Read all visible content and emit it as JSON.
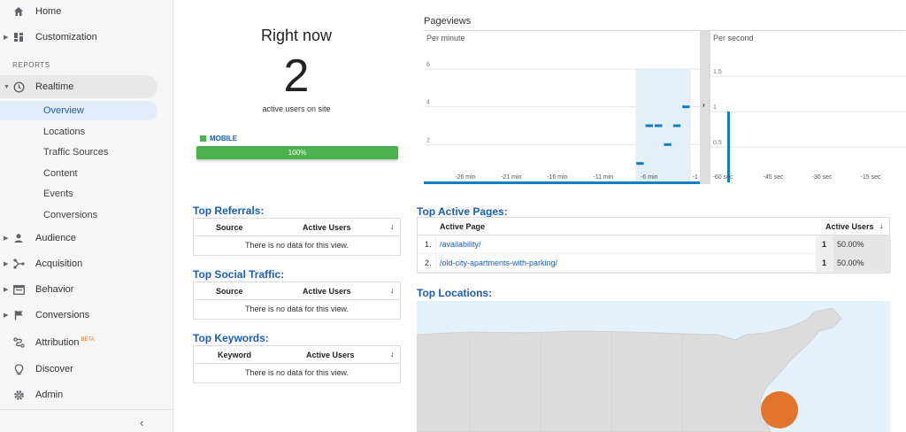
{
  "sidebar": {
    "home": "Home",
    "customization": "Customization",
    "reports_label": "REPORTS",
    "realtime": "Realtime",
    "realtime_items": [
      "Overview",
      "Locations",
      "Traffic Sources",
      "Content",
      "Events",
      "Conversions"
    ],
    "audience": "Audience",
    "acquisition": "Acquisition",
    "behavior": "Behavior",
    "conversions": "Conversions",
    "attribution": "Attribution",
    "attribution_badge": "BETA",
    "discover": "Discover",
    "admin": "Admin",
    "collapse": "‹"
  },
  "right_now": {
    "title": "Right now",
    "count": "2",
    "subtitle": "active users on site",
    "device": "MOBILE",
    "device_pct": "100%"
  },
  "pageviews": {
    "title": "Pageviews",
    "per_minute_label": "Per minute",
    "per_second_label": "Per second"
  },
  "chart_data": [
    {
      "type": "bar",
      "title": "Per minute",
      "ylim": [
        0,
        6
      ],
      "yticks": [
        "2",
        "4",
        "6"
      ],
      "xticks": [
        "-26 min",
        "-21 min",
        "-16 min",
        "-11 min",
        "-6 min",
        "-1"
      ],
      "categories": [
        "-30",
        "-29",
        "-28",
        "-27",
        "-26",
        "-25",
        "-24",
        "-23",
        "-22",
        "-21",
        "-20",
        "-19",
        "-18",
        "-17",
        "-16",
        "-15",
        "-14",
        "-13",
        "-12",
        "-11",
        "-10",
        "-9",
        "-8",
        "-7",
        "-6",
        "-5",
        "-4",
        "-3",
        "-2",
        "-1"
      ],
      "values": [
        0,
        0,
        0,
        0,
        0,
        0,
        0,
        0,
        0,
        0,
        0,
        0,
        0,
        0,
        0,
        0,
        0,
        0,
        0,
        0,
        0,
        0,
        0,
        1,
        3,
        3,
        2,
        3,
        4,
        0
      ]
    },
    {
      "type": "bar",
      "title": "Per second",
      "ylim": [
        0,
        1.5
      ],
      "yticks": [
        "0.5",
        "1",
        "1.5"
      ],
      "xticks": [
        "-60 sec",
        "-45 sec",
        "-30 sec",
        "-15 sec"
      ],
      "values": [
        1
      ]
    }
  ],
  "top_referrals": {
    "title": "Top Referrals:",
    "col1": "Source",
    "col2": "Active Users",
    "empty": "There is no data for this view."
  },
  "top_social": {
    "title": "Top Social Traffic:",
    "col1": "Source",
    "col2": "Active Users",
    "empty": "There is no data for this view."
  },
  "top_keywords": {
    "title": "Top Keywords:",
    "col1": "Keyword",
    "col2": "Active Users",
    "empty": "There is no data for this view."
  },
  "sort_arrow": "↓",
  "top_active_pages": {
    "title": "Top Active Pages:",
    "col1": "Active Page",
    "col2": "Active Users",
    "rows": [
      {
        "rank": "1.",
        "page": "/availability/",
        "count": "1",
        "pct": "50.00%"
      },
      {
        "rank": "2.",
        "page": "/old-city-apartments-with-parking/",
        "count": "1",
        "pct": "50.00%"
      }
    ]
  },
  "top_locations": {
    "title": "Top Locations:"
  },
  "colors": {
    "accent": "#1a5fb4",
    "bar": "#0e7fbf",
    "mobile": "#4caf50",
    "marker": "#e3742e"
  }
}
